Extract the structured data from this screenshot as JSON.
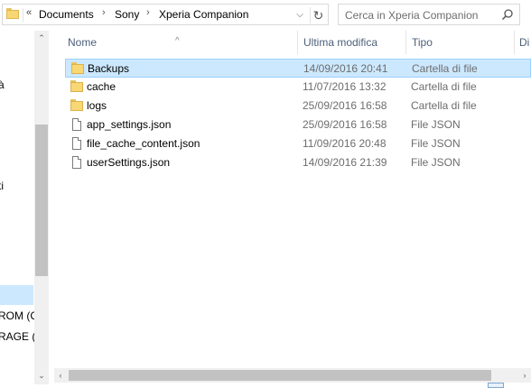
{
  "address_bar": {
    "overflow_label": "«",
    "crumbs": [
      "Documents",
      "Sony",
      "Xperia Companion"
    ],
    "chevron": "›",
    "dropdown_glyph": "⌵",
    "refresh_glyph": "↻"
  },
  "search": {
    "placeholder": "Cerca in Xperia Companion"
  },
  "nav_pane": {
    "fragments": [
      "à",
      "ti",
      "l",
      "ROM (C",
      "RAGE (H"
    ],
    "scroll_up": "⌃",
    "scroll_down": "⌄"
  },
  "columns": {
    "name": "Nome",
    "modified": "Ultima modifica",
    "type": "Tipo",
    "size_cut": "Di"
  },
  "files": [
    {
      "name": "Backups",
      "modified": "14/09/2016 20:41",
      "type": "Cartella di file",
      "kind": "folder",
      "selected": true
    },
    {
      "name": "cache",
      "modified": "11/07/2016 13:32",
      "type": "Cartella di file",
      "kind": "folder",
      "selected": false
    },
    {
      "name": "logs",
      "modified": "25/09/2016 16:58",
      "type": "Cartella di file",
      "kind": "folder",
      "selected": false
    },
    {
      "name": "app_settings.json",
      "modified": "25/09/2016 16:58",
      "type": "File JSON",
      "kind": "file",
      "selected": false
    },
    {
      "name": "file_cache_content.json",
      "modified": "11/09/2016 20:48",
      "type": "File JSON",
      "kind": "file",
      "selected": false
    },
    {
      "name": "userSettings.json",
      "modified": "14/09/2016 21:39",
      "type": "File JSON",
      "kind": "file",
      "selected": false
    }
  ],
  "hscroll": {
    "left": "‹",
    "right": "›"
  },
  "colors": {
    "selection": "#cce8ff",
    "header_text": "#4c607a",
    "folder": "#f8d775"
  }
}
